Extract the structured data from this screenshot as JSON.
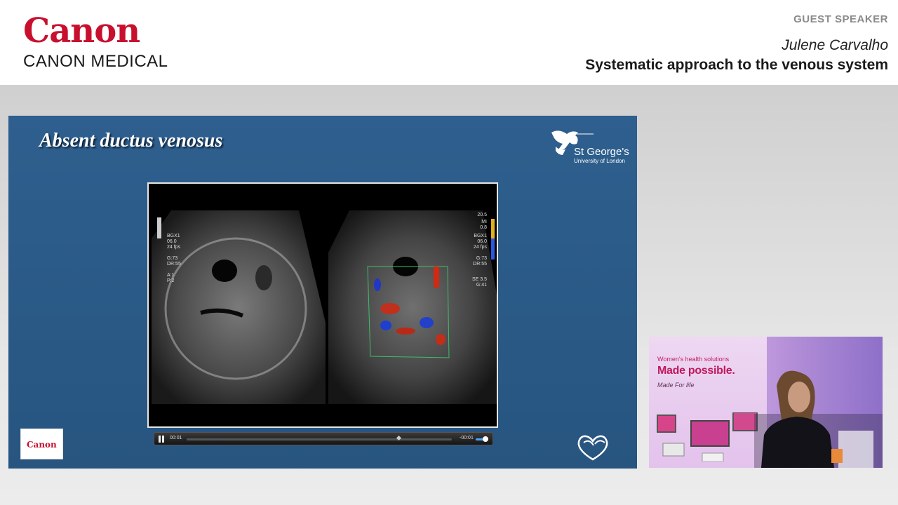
{
  "header": {
    "brand_logo_text": "Canon",
    "brand_subtitle": "CANON MEDICAL",
    "guest_label": "GUEST SPEAKER",
    "speaker_name": "Julene Carvalho",
    "talk_title": "Systematic approach to the venous system"
  },
  "slide": {
    "title": "Absent ductus venosus",
    "institution_name": "St George's",
    "institution_subtitle": "University of London",
    "badge_text": "Canon",
    "ultrasound_left_labels": [
      "BGX1",
      "06.0",
      "24 fps",
      "G:73",
      "DR:55",
      "A:1",
      "P:2"
    ],
    "ultrasound_right_labels": [
      "20.5",
      "MI",
      "0.8",
      "BGX1",
      "06.0",
      "24 fps",
      "G:73",
      "DR:55",
      "SE 3.5",
      "G:41"
    ]
  },
  "player": {
    "current_time": "00:01",
    "remaining_time": "-00:01",
    "state": "playing",
    "progress": 0.8,
    "volume": 0.8
  },
  "camera_feed": {
    "banner_line1": "Women's health solutions",
    "banner_line2": "Made possible.",
    "banner_line3": "Made For life"
  },
  "colors": {
    "brand_red": "#c8102e",
    "slide_blue": "#2b5a86",
    "banner_magenta": "#c0185c"
  }
}
